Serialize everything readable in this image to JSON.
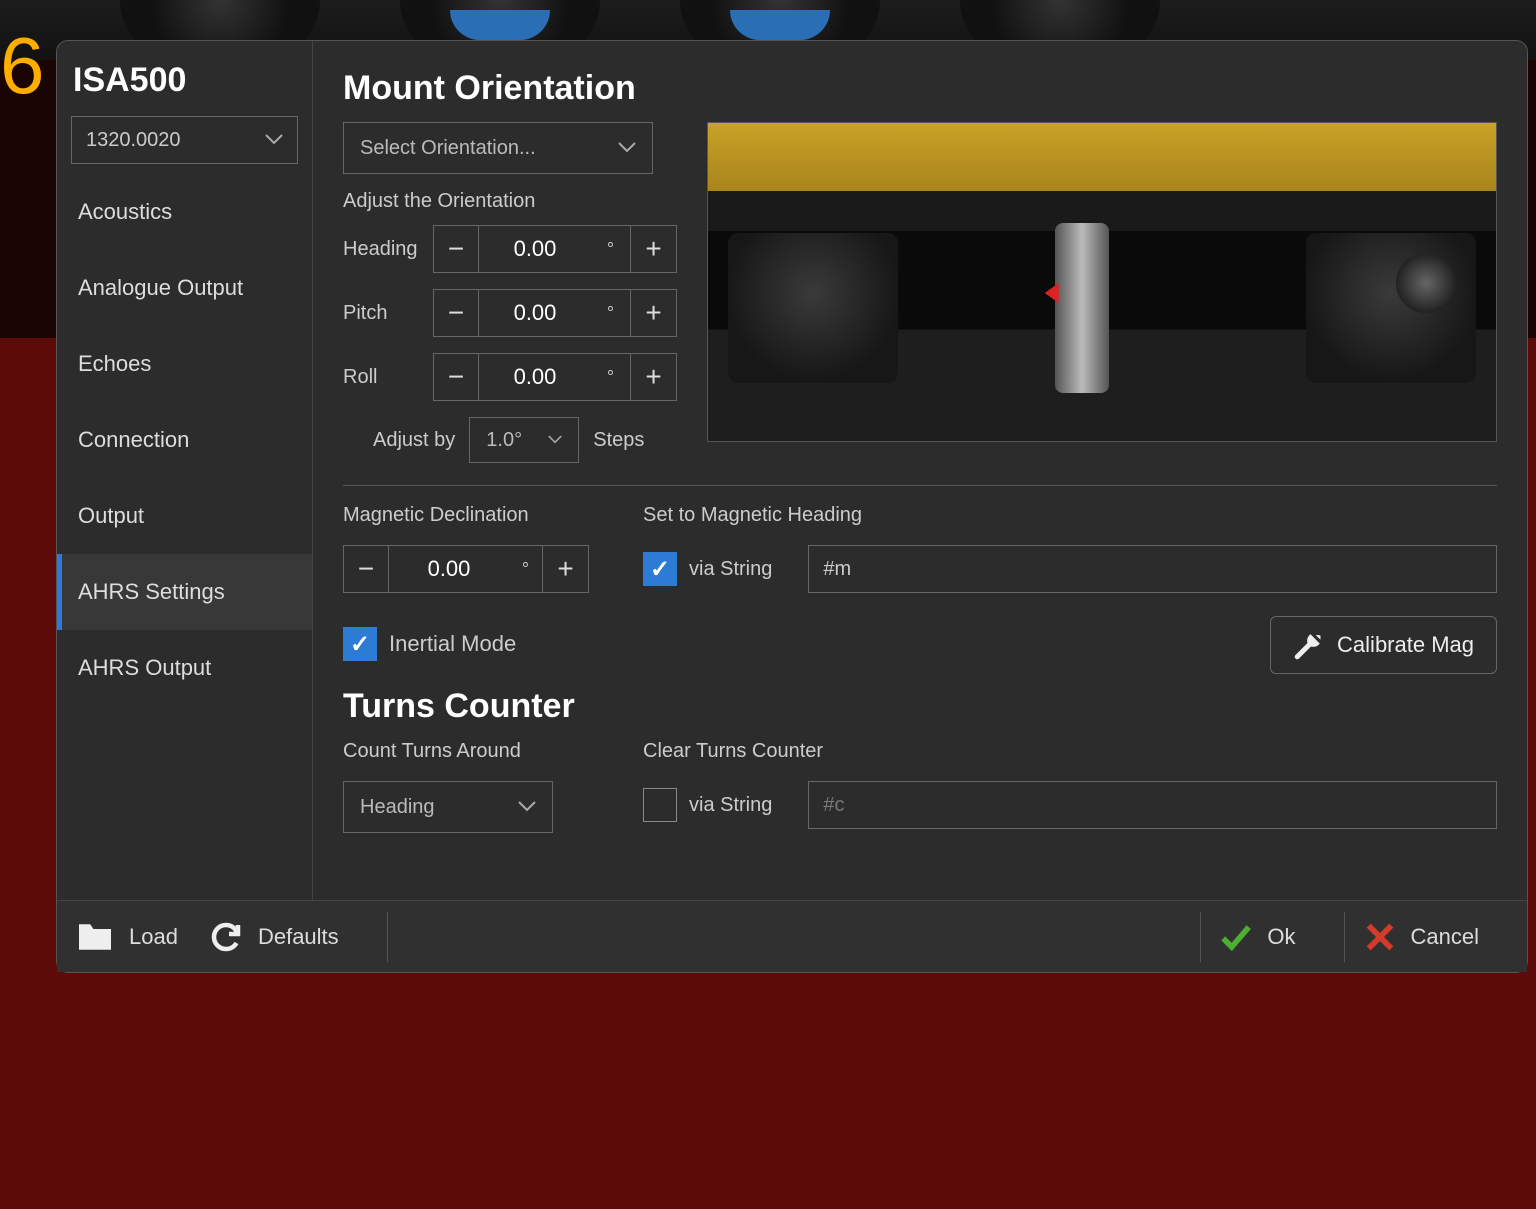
{
  "big6": "6",
  "sidebar": {
    "title": "ISA500",
    "device": "1320.0020",
    "items": [
      {
        "label": "Acoustics"
      },
      {
        "label": "Analogue Output"
      },
      {
        "label": "Echoes"
      },
      {
        "label": "Connection"
      },
      {
        "label": "Output"
      },
      {
        "label": "AHRS Settings"
      },
      {
        "label": "AHRS Output"
      }
    ],
    "active_index": 5
  },
  "main": {
    "mount_title": "Mount Orientation",
    "orientation_select": "Select Orientation...",
    "adjust_label": "Adjust the Orientation",
    "rows": [
      {
        "name": "Heading",
        "value": "0.00",
        "unit": "°"
      },
      {
        "name": "Pitch",
        "value": "0.00",
        "unit": "°"
      },
      {
        "name": "Roll",
        "value": "0.00",
        "unit": "°"
      }
    ],
    "adjust_by_label": "Adjust by",
    "adjust_by_value": "1.0°",
    "adjust_by_suffix": "Steps",
    "mag_decl_label": "Magnetic Declination",
    "mag_decl_value": "0.00",
    "mag_decl_unit": "°",
    "set_mag_label": "Set to Magnetic Heading",
    "via_string": "via String",
    "mag_string_value": "#m",
    "inertial": "Inertial Mode",
    "calibrate": "Calibrate Mag",
    "turns_title": "Turns Counter",
    "count_label": "Count Turns Around",
    "count_value": "Heading",
    "clear_label": "Clear Turns Counter",
    "clear_string_placeholder": "#c"
  },
  "footer": {
    "load": "Load",
    "defaults": "Defaults",
    "ok": "Ok",
    "cancel": "Cancel"
  },
  "minus": "−",
  "plus": "+"
}
